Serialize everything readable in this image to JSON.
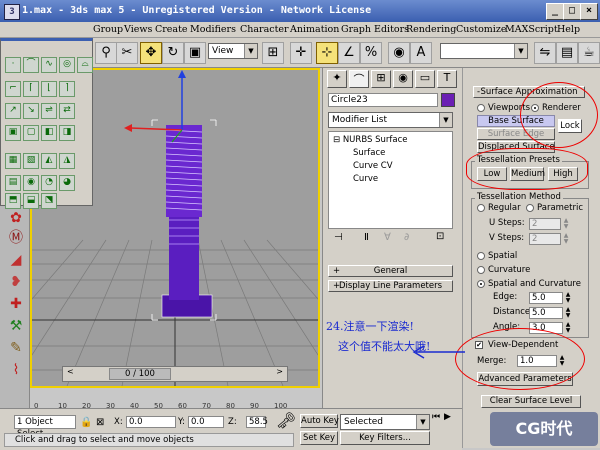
{
  "window": {
    "title": "1.max - 3ds max 5 - Unregistered Version - Network License",
    "controls": [
      "_",
      "□",
      "×"
    ]
  },
  "menu": {
    "items": [
      "Group",
      "Views",
      "Create",
      "Modifiers",
      "Character",
      "Animation",
      "Graph Editors",
      "Rendering",
      "Customize",
      "MAXScript",
      "Help"
    ]
  },
  "toolbar": {
    "view_select": "View"
  },
  "viewport": {
    "time_slider": "0 / 100",
    "ruler": [
      "0",
      "10",
      "20",
      "30",
      "40",
      "50",
      "60",
      "70",
      "80",
      "90",
      "100"
    ]
  },
  "command_panel": {
    "object_name": "Circle23",
    "object_color": "#6b1fb4",
    "modifier_list": "Modifier List",
    "stack": [
      "NURBS Surface",
      "Surface",
      "Curve CV",
      "Curve"
    ],
    "rollouts": [
      "General",
      "Display Line Parameters"
    ]
  },
  "surface_approx": {
    "title": "Surface Approximation",
    "viewports_label": "Viewports",
    "renderer_label": "Renderer",
    "base_surface": "Base Surface",
    "surface_edge": "Surface Edge",
    "lock": "Lock",
    "displaced_surface": "Displaced Surface",
    "presets_title": "Tessellation Presets",
    "presets": [
      "Low",
      "Medium",
      "High"
    ],
    "method_title": "Tessellation Method",
    "regular": "Regular",
    "parametric": "Parametric",
    "u_steps_label": "U Steps:",
    "u_steps": "2",
    "v_steps_label": "V Steps:",
    "v_steps": "2",
    "spatial": "Spatial",
    "curvature": "Curvature",
    "spatial_curvature": "Spatial and Curvature",
    "edge_label": "Edge:",
    "edge": "5.0",
    "distance_label": "Distance:",
    "distance": "5.0",
    "angle_label": "Angle:",
    "angle": "3.0",
    "view_dependent": "View-Dependent",
    "merge_label": "Merge:",
    "merge": "1.0",
    "advanced": "Advanced Parameters",
    "clear_level": "Clear Surface Level"
  },
  "annotation": {
    "line1": "24.注意一下渲染!",
    "line2": "这个值不能太大哦!"
  },
  "status": {
    "selection": "1 Object Select",
    "x_label": "X:",
    "x_value": "0.0",
    "y_label": "Y:",
    "y_value": "0.0",
    "z_label": "Z:",
    "z_value": "58.5",
    "prompt": "Click and drag to select and move objects",
    "auto_key": "Auto Key",
    "selected": "Selected",
    "set_key": "Set Key",
    "key_filters": "Key Filters..."
  },
  "watermark": "CG时代"
}
